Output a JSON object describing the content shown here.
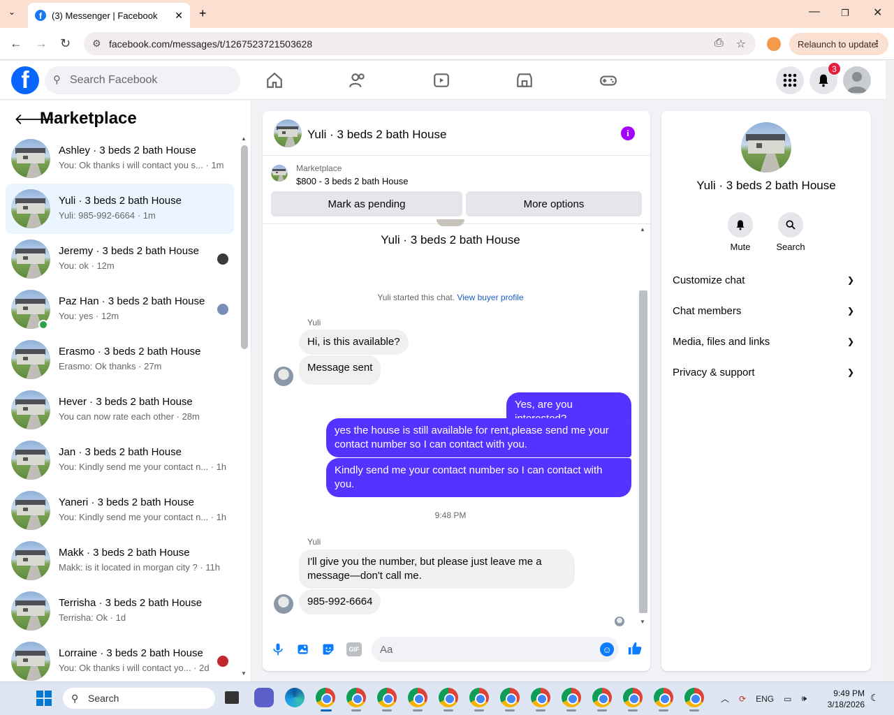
{
  "browser": {
    "tab_title": "(3) Messenger | Facebook",
    "url": "facebook.com/messages/t/1267523721503628",
    "relaunch_label": "Relaunch to update"
  },
  "fb": {
    "search_placeholder": "Search Facebook",
    "notification_count": "3"
  },
  "sidebar": {
    "title": "Marketplace",
    "conversations": [
      {
        "name": "Ashley · 3 beds 2 bath House",
        "snippet": "You: Ok thanks i will contact you s... · 1m"
      },
      {
        "name": "Yuli · 3 beds 2 bath House",
        "snippet": "Yuli: 985-992-6664 · 1m"
      },
      {
        "name": "Jeremy · 3 beds 2 bath House",
        "snippet": "You: ok · 12m"
      },
      {
        "name": "Paz Han · 3 beds 2 bath House",
        "snippet": "You: yes · 12m"
      },
      {
        "name": "Erasmo · 3 beds 2 bath House",
        "snippet": "Erasmo: Ok thanks · 27m"
      },
      {
        "name": "Hever · 3 beds 2 bath House",
        "snippet": "You can now rate each other · 28m"
      },
      {
        "name": "Jan · 3 beds 2 bath House",
        "snippet": "You: Kindly send me your contact n... · 1h"
      },
      {
        "name": "Yaneri · 3 beds 2 bath House",
        "snippet": "You: Kindly send me your contact n... · 1h"
      },
      {
        "name": "Makk · 3 beds 2 bath House",
        "snippet": "Makk: is it located in morgan city ? · 11h"
      },
      {
        "name": "Terrisha · 3 beds 2 bath House",
        "snippet": "Terrisha: Ok · 1d"
      },
      {
        "name": "Lorraine · 3 beds 2 bath House",
        "snippet": "You: Ok thanks i will contact yo... · 2d"
      }
    ]
  },
  "chat": {
    "title": "Yuli · 3 beds 2 bath House",
    "marketplace_label": "Marketplace",
    "listing": "$800 - 3 beds 2 bath House",
    "btn_pending": "Mark as pending",
    "btn_more": "More options",
    "top_name": "Yuli · 3 beds 2 bath House",
    "system_text": "Yuli started this chat.",
    "system_link": "View buyer profile",
    "sender": "Yuli",
    "messages_in_1": [
      "Hi, is this available?",
      "Message sent"
    ],
    "messages_out": [
      "Yes, are you interested?",
      "yes the house is still available for rent,please send me your contact number so I can contact with you.",
      "Kindly send me your contact number so I can contact with you."
    ],
    "timestamp": "9:48 PM",
    "messages_in_2": [
      "I'll give you the number, but please just leave me a message—don't call me.",
      "985-992-6664"
    ],
    "input_placeholder": "Aa"
  },
  "right_panel": {
    "name": "Yuli · 3 beds 2 bath House",
    "mute_label": "Mute",
    "search_label": "Search",
    "rows": [
      "Customize chat",
      "Chat members",
      "Media, files and links",
      "Privacy & support"
    ]
  },
  "taskbar": {
    "search_label": "Search",
    "lang": "ENG",
    "time": "9:49 PM",
    "date": "3/18/2026"
  },
  "colors": {
    "fb_blue": "#0866ff",
    "outgoing_bubble": "#5233ff",
    "active_conv": "#ebf5ff"
  }
}
